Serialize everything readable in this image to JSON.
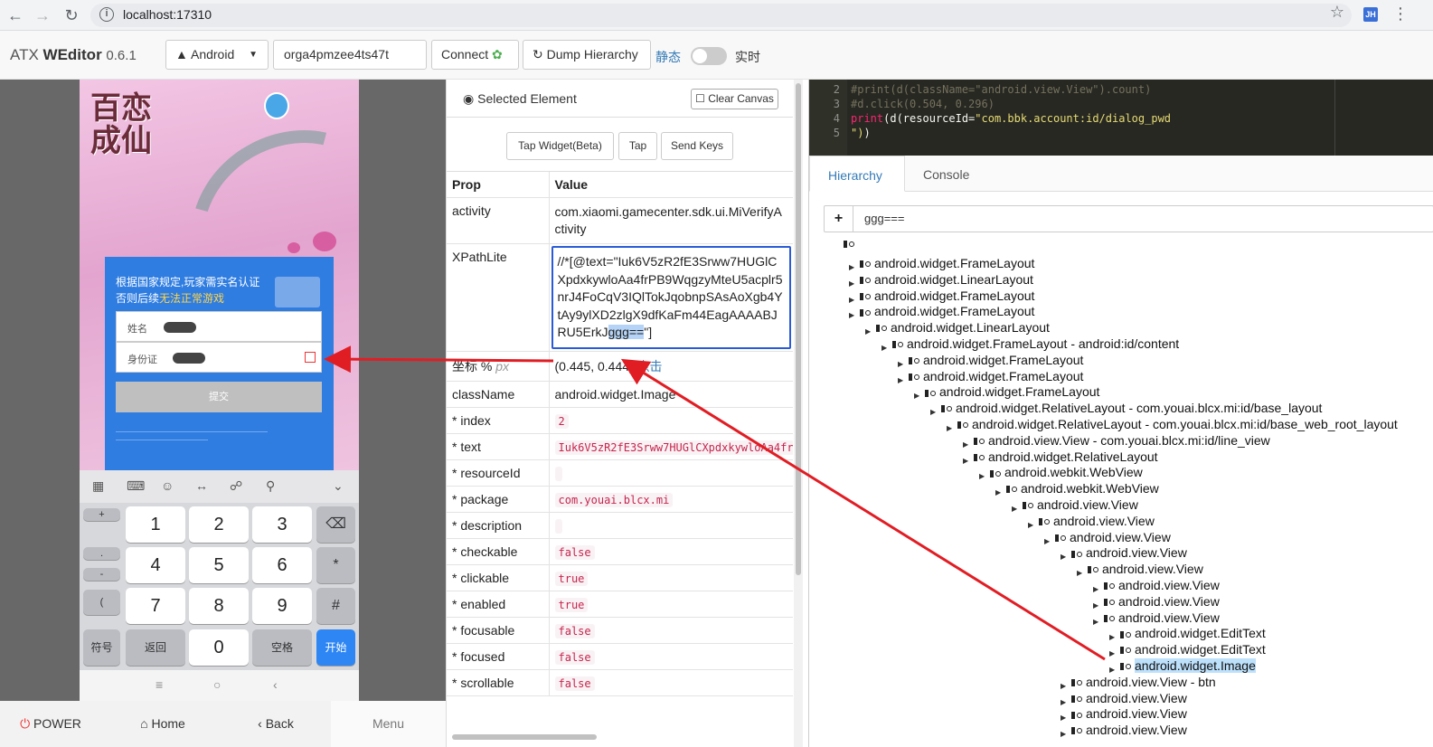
{
  "browser": {
    "url": "localhost:17310",
    "ext_badge": "JH"
  },
  "toolbar": {
    "brand_prefix": "ATX ",
    "brand_name": "WEditor",
    "version": "0.6.1",
    "platform": "Android",
    "serial": "orga4pmzee4ts47t",
    "connect_label": "Connect",
    "dump_label": "Dump Hierarchy",
    "mode_static": "静态",
    "mode_live": "实时",
    "live_enabled": false
  },
  "device": {
    "game_title": "百恋成仙",
    "dialog_line1": "根据国家规定,玩家需实名认证",
    "dialog_line2_prefix": "否则后续",
    "dialog_line2_warn": "无法正常游戏",
    "name_label": "姓名",
    "id_label": "身份证",
    "submit_label": "提交",
    "keys": {
      "digits": [
        "1",
        "2",
        "3",
        "4",
        "5",
        "6",
        "7",
        "8",
        "9",
        "0"
      ],
      "sym_plus": "+",
      "sym_dot": ".",
      "sym_minus": "-",
      "sym_paren": "(",
      "star": "*",
      "hash": "#",
      "symbol": "符号",
      "back": "返回",
      "space": "空格",
      "go": "开始"
    },
    "buttons": {
      "power": "POWER",
      "home": "Home",
      "back": "Back",
      "menu": "Menu"
    }
  },
  "props": {
    "header_title": "Selected Element",
    "clear_canvas": "Clear Canvas",
    "actions": [
      "Tap Widget(Beta)",
      "Tap",
      "Send Keys"
    ],
    "col_prop": "Prop",
    "col_value": "Value",
    "activity": "com.xiaomi.gamecenter.sdk.ui.MiVerifyActivity",
    "xpath_prefix": "//*[@text=\"Iuk6V5zR2fE3Srww7HUGlCXpdxkywloAa4frPB9WqgzyMteU5acplr5nrJ4FoCqV3IQlTokJqobnpSAsAoXgb4YtAy9ylXD2zlgX9dfKaFm44EagAAAABJRU5ErkJ",
    "xpath_selected": "ggg==",
    "xpath_suffix": "\"]",
    "coord_label": "坐标 %",
    "coord_unit": "px",
    "coord_value": "(0.445, 0.444)",
    "coord_click": "点击",
    "className": "android.widget.Image",
    "index": "2",
    "text": "Iuk6V5zR2fE3Srww7HUGlCXpdxkywloAa4fr",
    "resourceId": "",
    "package": "com.youai.blcx.mi",
    "description": "",
    "checkable": "false",
    "clickable": "true",
    "enabled": "true",
    "focusable": "false",
    "focused": "false",
    "scrollable": "false"
  },
  "editor": {
    "lines": [
      {
        "n": "2",
        "text": "#print(d(className=\"android.view.View\").count)"
      },
      {
        "n": "3",
        "text": "#d.click(0.504, 0.296)"
      },
      {
        "n": "4",
        "fn": "print",
        "rest": "(d(resourceId=",
        "str": "\"com.bbk.account:id/dialog_pwd"
      },
      {
        "n": "5",
        "str": "\")",
        "rest": ")"
      }
    ]
  },
  "hierarchy": {
    "tab_hierarchy": "Hierarchy",
    "tab_console": "Console",
    "search_plus": "+",
    "search_query": "ggg===",
    "nodes": [
      "android.widget.FrameLayout",
      "android.widget.LinearLayout",
      "android.widget.FrameLayout",
      "android.widget.FrameLayout",
      "android.widget.LinearLayout",
      "android.widget.FrameLayout - android:id/content",
      "android.widget.FrameLayout",
      "android.widget.FrameLayout",
      "android.widget.FrameLayout",
      "android.widget.RelativeLayout - com.youai.blcx.mi:id/base_layout",
      "android.widget.RelativeLayout - com.youai.blcx.mi:id/base_web_root_layout",
      "android.view.View - com.youai.blcx.mi:id/line_view",
      "android.widget.RelativeLayout",
      "android.webkit.WebView",
      "android.webkit.WebView",
      "android.view.View",
      "android.view.View",
      "android.view.View",
      "android.view.View",
      "android.view.View",
      "android.view.View",
      "android.view.View",
      "android.view.View",
      "android.widget.EditText",
      "android.widget.EditText",
      "android.widget.Image",
      "android.view.View - btn",
      "android.view.View",
      "android.view.View",
      "android.view.View"
    ]
  },
  "colors": {
    "accent": "#337ab7",
    "arrow": "#e11d24",
    "selection": "#bde0fb"
  }
}
